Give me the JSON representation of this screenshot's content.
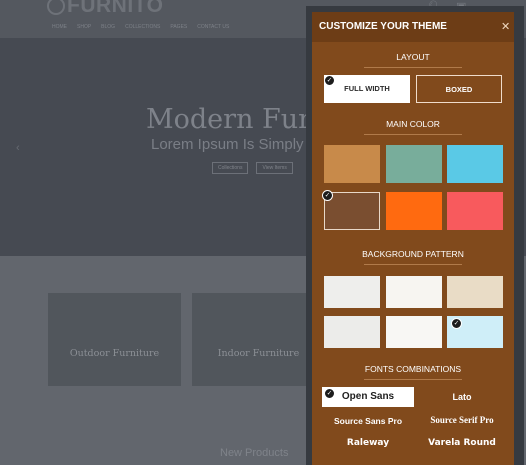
{
  "site": {
    "logo": "FURNITO",
    "nav": [
      "HOME",
      "SHOP",
      "BLOG",
      "COLLECTIONS",
      "PAGES",
      "CONTACT US"
    ],
    "hero_title": "Modern Furni",
    "hero_subtitle": "Lorem Ipsum Is Simply",
    "hero_buttons": [
      "Collections",
      "View Items"
    ],
    "categories": [
      "Outdoor Furniture",
      "Indoor Furniture"
    ],
    "section_heading": "New Products"
  },
  "panel": {
    "title": "CUSTOMIZE YOUR THEME",
    "close_icon": "close-icon",
    "layout": {
      "heading": "LAYOUT",
      "options": [
        "FULL WIDTH",
        "BOXED"
      ],
      "selected": "FULL WIDTH"
    },
    "main_color": {
      "heading": "MAIN COLOR",
      "colors": [
        "#c88a4a",
        "#78ad9b",
        "#5ac9e6",
        "#7a4e30",
        "#ff6a10",
        "#f85a5d"
      ],
      "selected": "#7a4e30"
    },
    "background_pattern": {
      "heading": "BACKGROUND PATTERN",
      "patterns": [
        "#eeeeec",
        "#f7f5f1",
        "#e9dcc6",
        "#ececea",
        "#f8f7f4",
        "#cfeef8"
      ],
      "selected_index": 5
    },
    "fonts": {
      "heading": "FONTS COMBINATIONS",
      "options": [
        "Open Sans",
        "Lato",
        "Source Sans Pro",
        "Source Serif Pro",
        "Raleway",
        "Varela Round"
      ],
      "selected": "Open Sans"
    }
  }
}
